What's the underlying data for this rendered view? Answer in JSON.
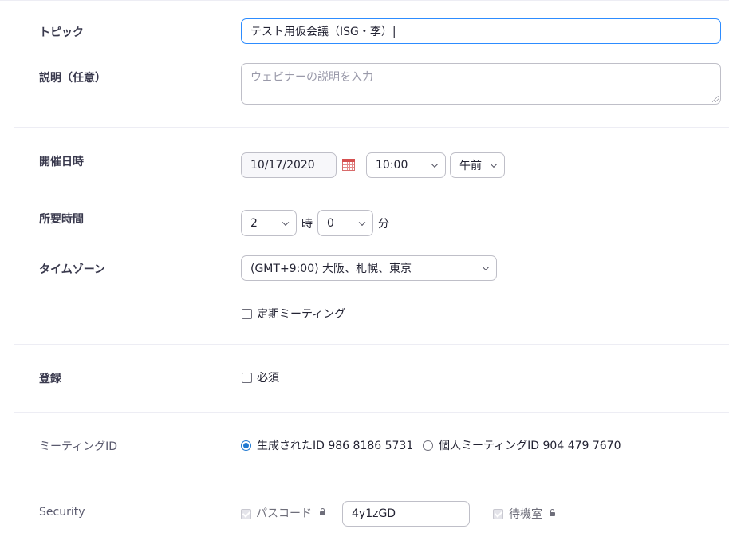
{
  "form": {
    "topic": {
      "label": "トピック",
      "value": "テスト用仮会議（ISG・李）|"
    },
    "description": {
      "label": "説明（任意）",
      "placeholder": "ウェビナーの説明を入力"
    },
    "when": {
      "label": "開催日時",
      "date": "10/17/2020",
      "time": "10:00",
      "ampm": "午前"
    },
    "duration": {
      "label": "所要時間",
      "hours": "2",
      "hours_unit": "時",
      "minutes": "0",
      "minutes_unit": "分"
    },
    "timezone": {
      "label": "タイムゾーン",
      "value": "(GMT+9:00) 大阪、札幌、東京"
    },
    "recurring": {
      "label": "定期ミーティング",
      "checked": false
    },
    "registration": {
      "label": "登録",
      "option_label": "必須",
      "checked": false
    },
    "meeting_id": {
      "label": "ミーティングID",
      "generated_label": "生成されたID 986 8186 5731",
      "personal_label": "個人ミーティングID 904 479 7670",
      "selected": "generated"
    },
    "security": {
      "label": "Security",
      "passcode_label": "パスコード",
      "passcode_value": "4y1zGD",
      "waiting_room_label": "待機室"
    }
  },
  "colors": {
    "accent": "#2d8cff",
    "radio": "#1f78d1",
    "divider": "#ededf4"
  },
  "icons": [
    "calendar-icon",
    "chevron-down-icon",
    "lock-icon",
    "resize-handle-icon"
  ]
}
